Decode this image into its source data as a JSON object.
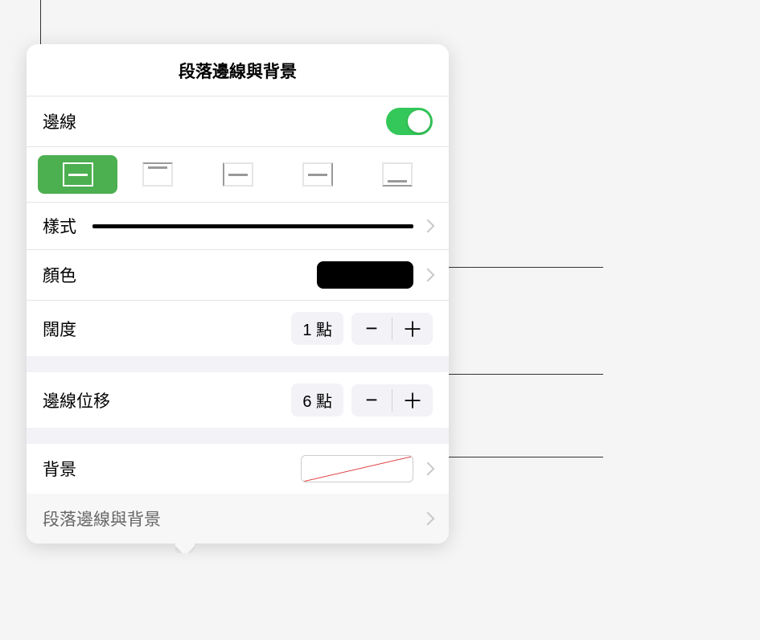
{
  "header": {
    "title": "段落邊線與背景"
  },
  "border": {
    "toggle_label": "邊線",
    "positions": {
      "full": "border-full",
      "top": "border-top",
      "left": "border-left",
      "right": "border-right",
      "bottom": "border-bottom"
    },
    "active_position": "full",
    "style_label": "樣式",
    "color_label": "顏色",
    "color_value": "#000000",
    "width_label": "闊度",
    "width_value": "1 點",
    "offset_label": "邊線位移",
    "offset_value": "6 點"
  },
  "background": {
    "label": "背景",
    "value": "none"
  },
  "footer": {
    "label": "段落邊線與背景"
  },
  "icons": {
    "minus": "−",
    "plus": "＋"
  }
}
